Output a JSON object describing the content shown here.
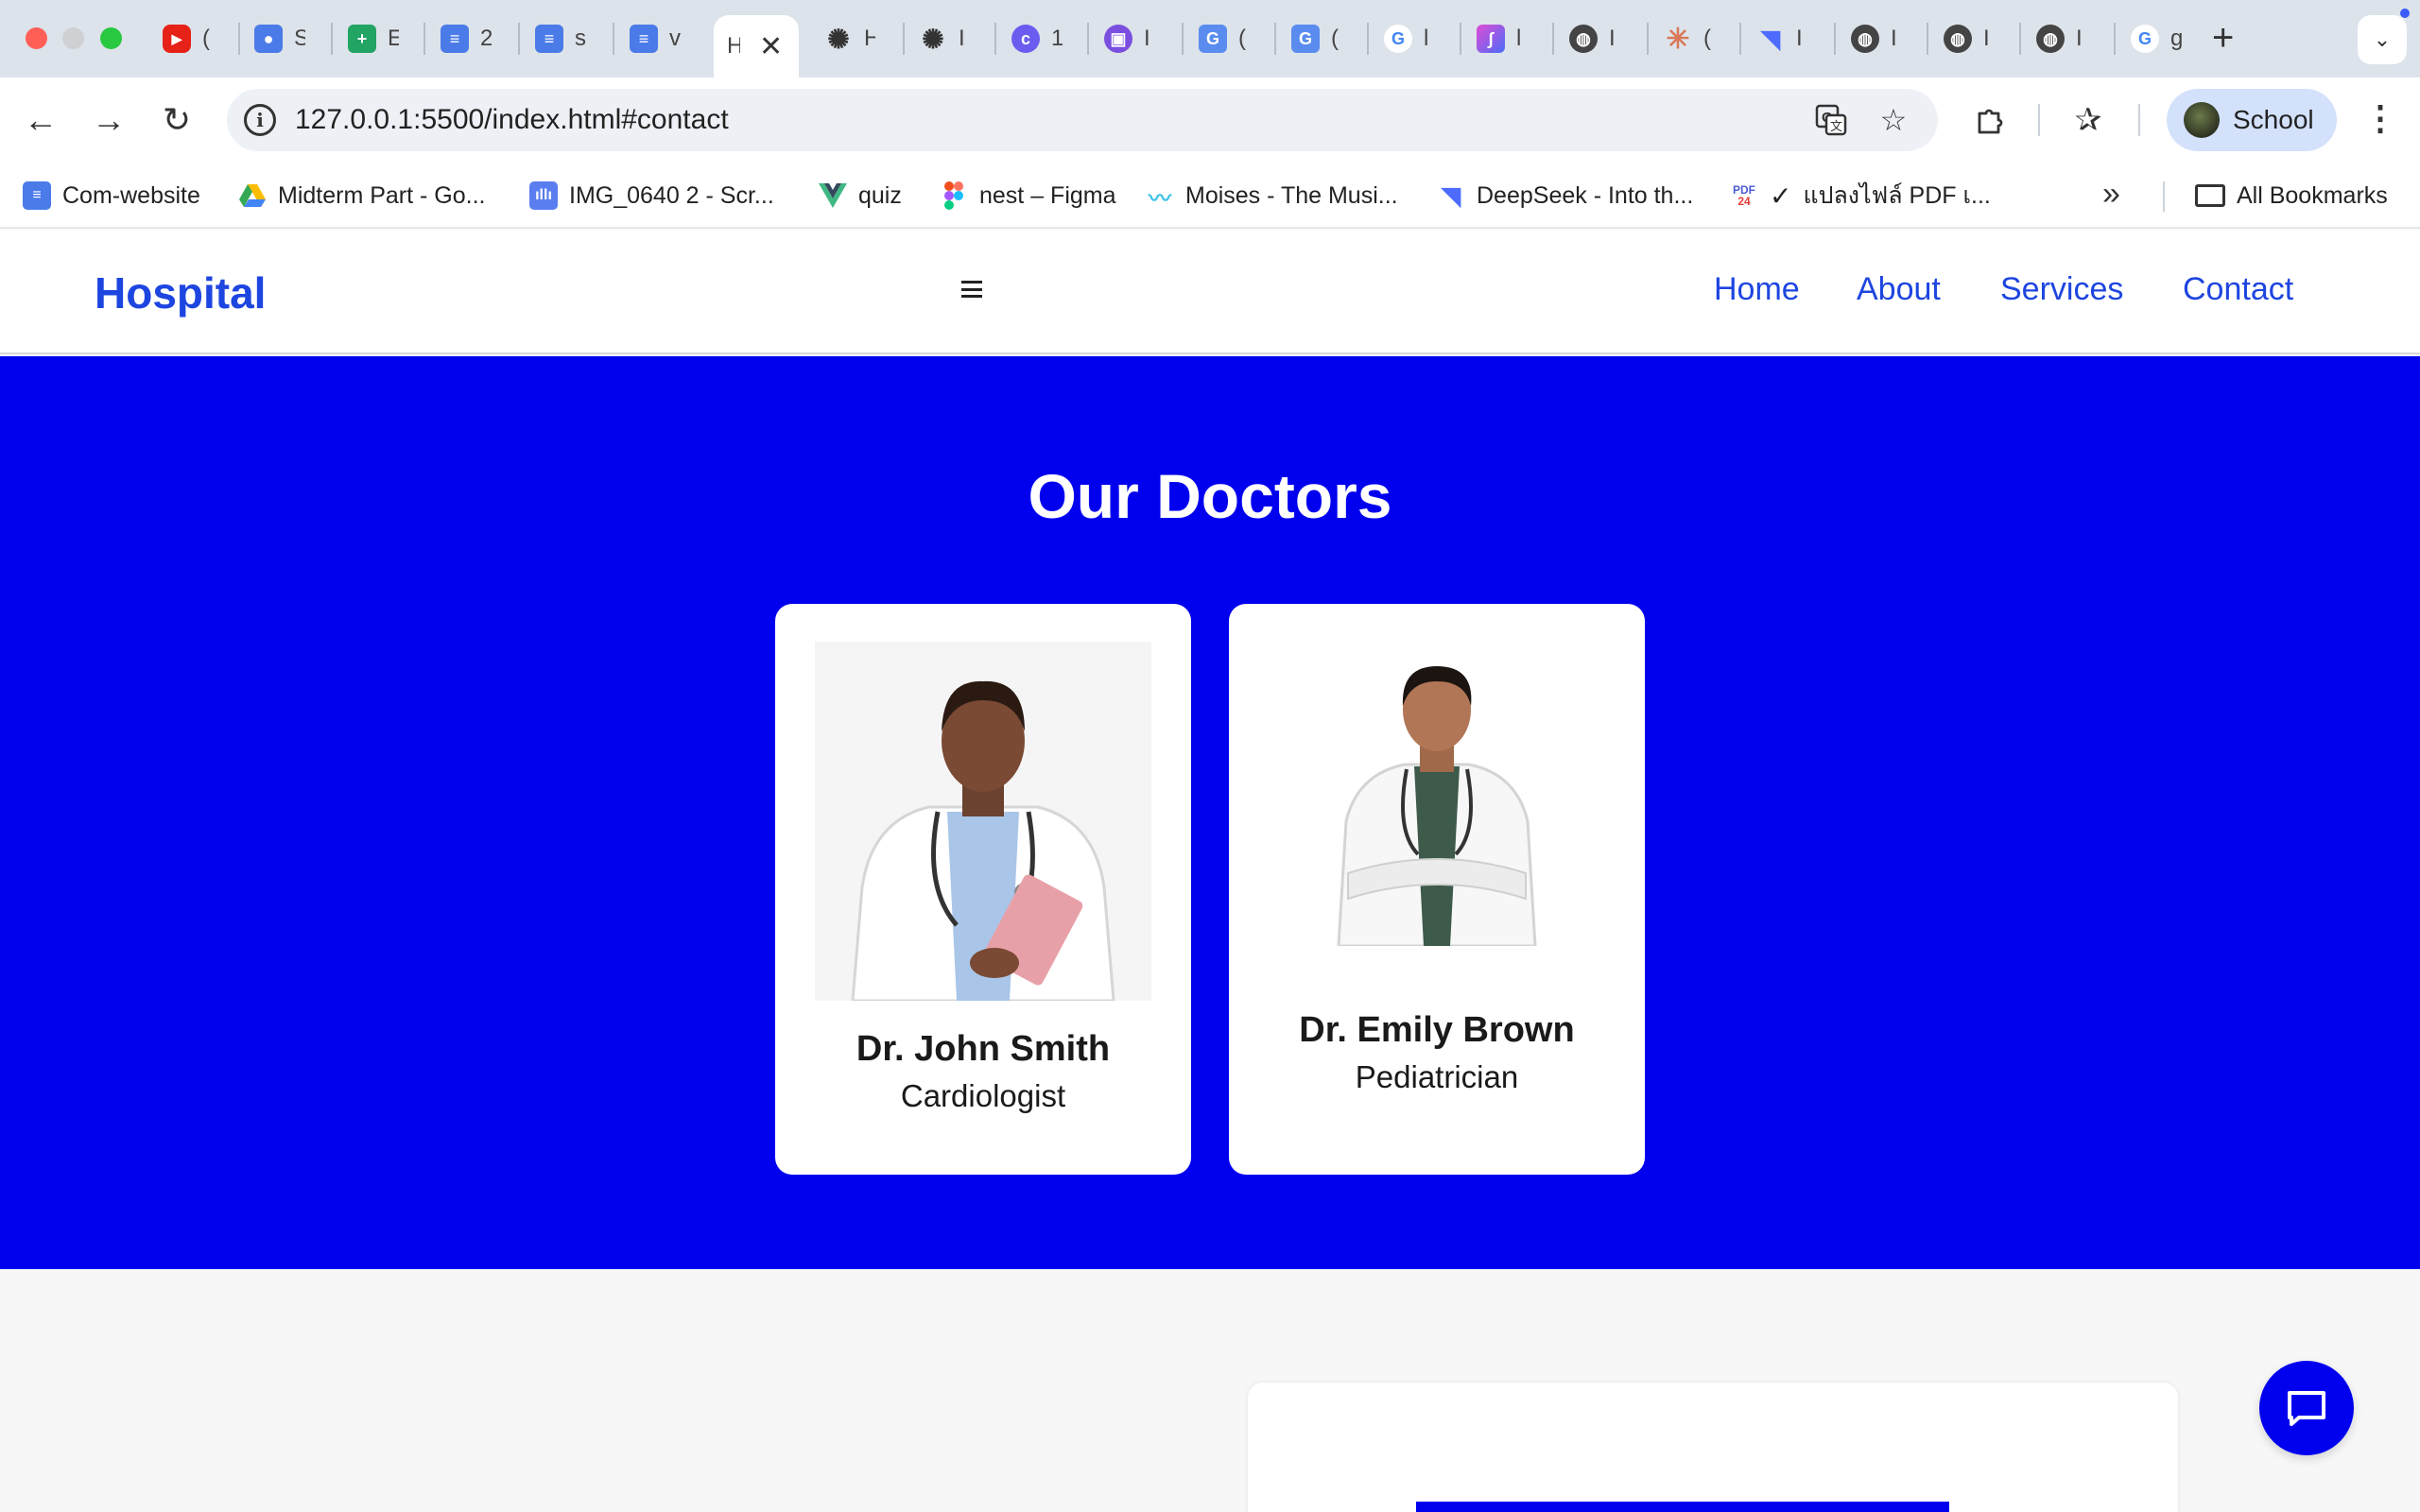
{
  "browser": {
    "active_tab": {
      "title": "H"
    },
    "tabs": [
      {
        "title": "(",
        "icon": "youtube-icon",
        "color": "#e62117"
      },
      {
        "title": "S",
        "icon": "contacts-icon",
        "color": "#4a7be8"
      },
      {
        "title": "E",
        "icon": "sheets-icon",
        "color": "#21a464"
      },
      {
        "title": "2",
        "icon": "docs-icon",
        "color": "#4a7be8"
      },
      {
        "title": "s",
        "icon": "docs-icon",
        "color": "#4a7be8"
      },
      {
        "title": "v",
        "icon": "docs-icon",
        "color": "#4a7be8"
      },
      {
        "title": "H",
        "icon": "openai-icon",
        "color": "#333333"
      },
      {
        "title": "I",
        "icon": "openai-icon",
        "color": "#333333"
      },
      {
        "title": "1",
        "icon": "canva-icon",
        "color": "#6b5cf0"
      },
      {
        "title": "I",
        "icon": "slides-icon",
        "color": "#7a4fe0"
      },
      {
        "title": "(",
        "icon": "translate-icon",
        "color": "#5a8cf0"
      },
      {
        "title": "(",
        "icon": "translate-icon",
        "color": "#5a8cf0"
      },
      {
        "title": "l",
        "icon": "google-icon",
        "color": "#4285f4"
      },
      {
        "title": "l",
        "icon": "app-icon",
        "color": "#c03ad0"
      },
      {
        "title": "I",
        "icon": "globe-icon",
        "color": "#444444"
      },
      {
        "title": "(",
        "icon": "claude-icon",
        "color": "#d97757"
      },
      {
        "title": "I",
        "icon": "deepseek-icon",
        "color": "#4d6bfe"
      },
      {
        "title": "I",
        "icon": "globe-icon",
        "color": "#444444"
      },
      {
        "title": "I",
        "icon": "globe-icon",
        "color": "#444444"
      },
      {
        "title": "I",
        "icon": "globe-icon",
        "color": "#444444"
      },
      {
        "title": "g",
        "icon": "google-icon",
        "color": "#4285f4"
      }
    ],
    "url": "127.0.0.1:5500/index.html#contact",
    "profile_name": "School",
    "bookmarks": [
      {
        "label": "Com-website",
        "icon": "docs-icon"
      },
      {
        "label": "Midterm Part - Go...",
        "icon": "drive-icon"
      },
      {
        "label": "IMG_0640 2 - Scr...",
        "icon": "audio-icon"
      },
      {
        "label": "quiz",
        "icon": "vue-icon"
      },
      {
        "label": "nest – Figma",
        "icon": "figma-icon"
      },
      {
        "label": "Moises - The Musi...",
        "icon": "moises-icon"
      },
      {
        "label": "DeepSeek - Into th...",
        "icon": "deepseek-icon"
      },
      {
        "label": "แปลงไฟล์ PDF เ...",
        "icon": "pdf24-icon"
      }
    ],
    "all_bookmarks_label": "All Bookmarks",
    "pdf_badge": "PDF",
    "pdf_badge_sub": "24"
  },
  "site": {
    "logo": "Hospital",
    "nav": [
      "Home",
      "About",
      "Services",
      "Contact"
    ],
    "brand_color": "#0000ef",
    "link_color": "#1d45e0"
  },
  "doctors_section": {
    "title": "Our Doctors",
    "doctors": [
      {
        "name": "Dr. John Smith",
        "specialty": "Cardiologist"
      },
      {
        "name": "Dr. Emily Brown",
        "specialty": "Pediatrician"
      }
    ]
  },
  "chat": {
    "icon": "chat-icon"
  }
}
